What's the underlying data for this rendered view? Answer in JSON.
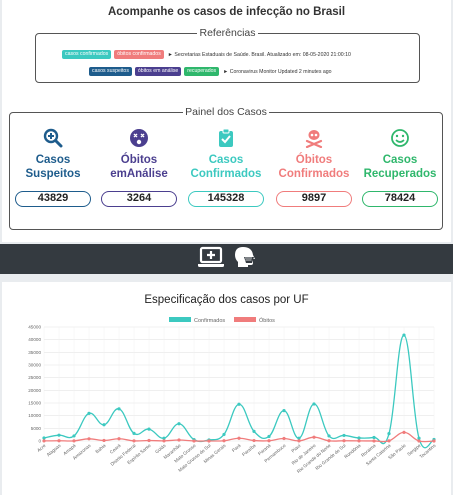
{
  "header": {
    "title": "Acompanhe os casos de infecção no Brasil"
  },
  "references": {
    "legend": "Referências",
    "row1": {
      "tags": [
        {
          "label": "casos confirmados",
          "color": "#3cc9c0"
        },
        {
          "label": "óbitos confirmados",
          "color": "#f07c7c"
        }
      ],
      "text": "► Secretarias Estaduais de Saúde. Brasil. Atualizado em: 08-05-2020 21:00:10"
    },
    "row2": {
      "tags": [
        {
          "label": "casos suspeitos",
          "color": "#1e5c8c"
        },
        {
          "label": "óbitos em análise",
          "color": "#4b3f8f"
        },
        {
          "label": "recuperados",
          "color": "#2fb76c"
        }
      ],
      "text": "► Coronavirus Monitor Updated 2 minutes ago"
    }
  },
  "panel": {
    "legend": "Painel dos Casos",
    "items": [
      {
        "label_line1": "Casos",
        "label_line2": "Suspeitos",
        "value": "43829",
        "color": "#1e5c8c",
        "icon": "search-plus-icon"
      },
      {
        "label_line1": "Óbitos",
        "label_line2": "emAnálise",
        "value": "3264",
        "color": "#4b3f8f",
        "icon": "dizzy-face-icon"
      },
      {
        "label_line1": "Casos",
        "label_line2": "Confirmados",
        "value": "145328",
        "color": "#3cc9c0",
        "icon": "clipboard-check-icon"
      },
      {
        "label_line1": "Óbitos",
        "label_line2": "Confirmados",
        "value": "9897",
        "color": "#f07c7c",
        "icon": "skull-crossbones-icon"
      },
      {
        "label_line1": "Casos",
        "label_line2": "Recuperados",
        "value": "78424",
        "color": "#2fb76c",
        "icon": "smile-icon"
      }
    ]
  },
  "toolbar": {
    "icons": [
      "laptop-medical-icon",
      "head-side-mask-icon"
    ]
  },
  "chart_data": {
    "type": "line",
    "title": "Especificação dos casos por UF",
    "legend_position": "top",
    "ylim": [
      0,
      45000
    ],
    "yticks": [
      0,
      5000,
      10000,
      15000,
      20000,
      25000,
      30000,
      35000,
      40000,
      45000
    ],
    "grid": true,
    "categories": [
      "Acre",
      "Alagoas",
      "Amapá",
      "Amazonas",
      "Bahia",
      "Ceará",
      "Distrito Federal",
      "Espírito Santo",
      "Goiás",
      "Maranhão",
      "Mato Grosso",
      "Mato Grosso do Sul",
      "Minas Gerais",
      "Pará",
      "Paraíba",
      "Paraná",
      "Pernambuco",
      "Piauí",
      "Rio de Janeiro",
      "Rio Grande do Norte",
      "Rio Grande do Sul",
      "Rondônia",
      "Roraima",
      "Santa Catarina",
      "São Paulo",
      "Sergipe",
      "Tocantins"
    ],
    "series": [
      {
        "name": "Confirmados",
        "color": "#3cc9c0",
        "values": [
          1200,
          2300,
          2000,
          10900,
          6400,
          12700,
          3000,
          4700,
          1100,
          6800,
          540,
          390,
          2600,
          14500,
          3800,
          1800,
          12000,
          1100,
          14600,
          2000,
          2200,
          1200,
          1400,
          2900,
          41800,
          1100,
          600
        ]
      },
      {
        "name": "Óbitos",
        "color": "#f07c7c",
        "values": [
          40,
          100,
          60,
          870,
          220,
          880,
          50,
          190,
          50,
          380,
          20,
          13,
          110,
          1100,
          180,
          100,
          1000,
          40,
          1500,
          90,
          90,
          40,
          20,
          60,
          3400,
          20,
          10
        ]
      }
    ]
  }
}
